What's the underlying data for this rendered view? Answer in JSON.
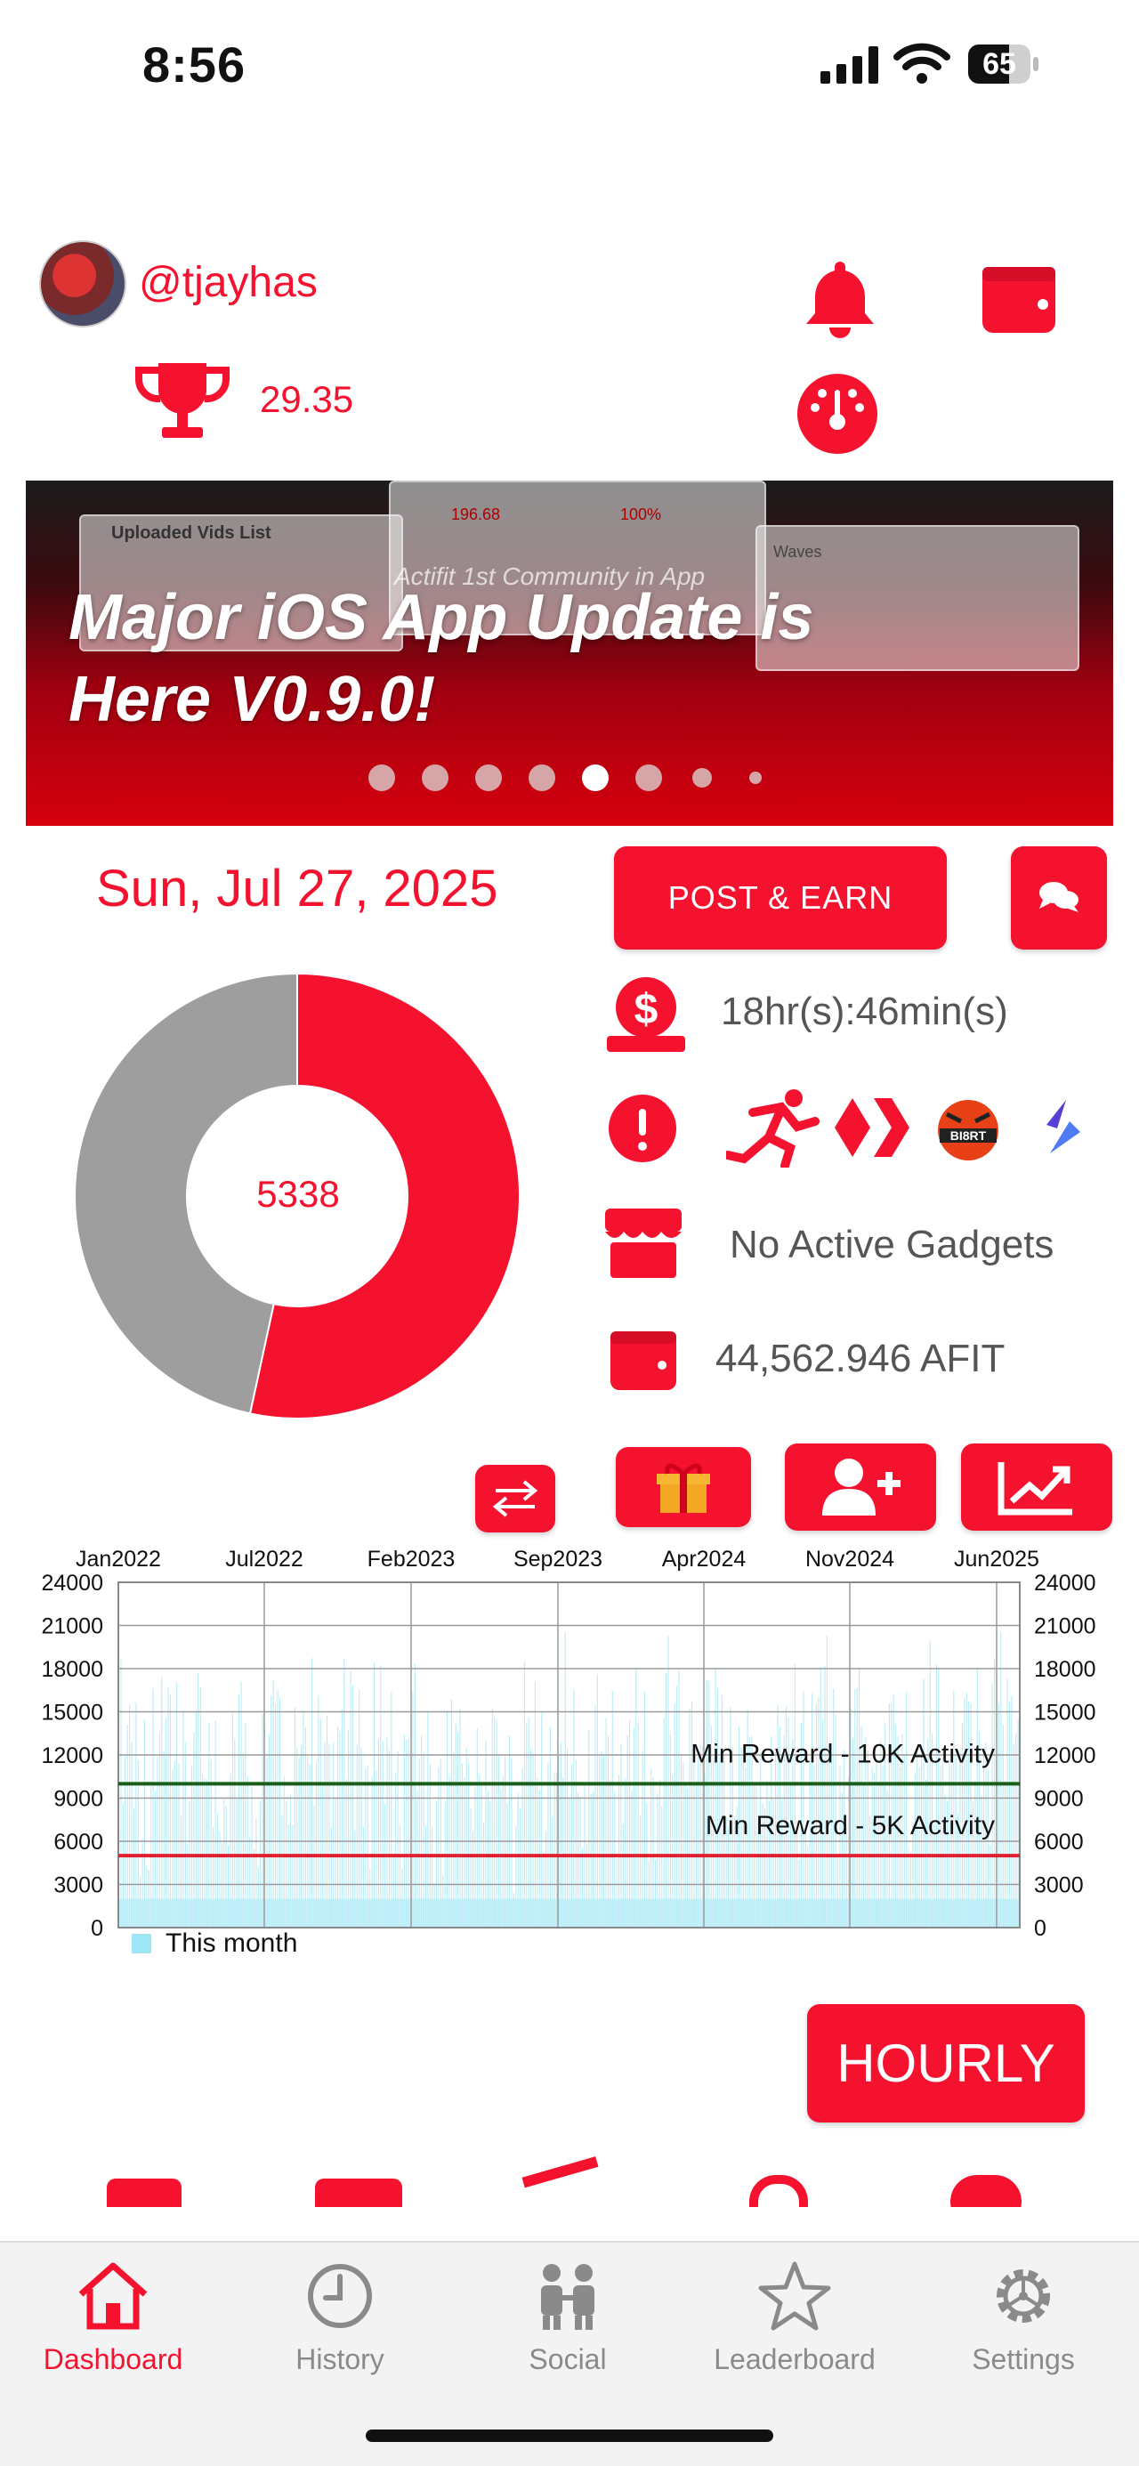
{
  "status_bar": {
    "time": "8:56",
    "battery": "65"
  },
  "header": {
    "username": "@tjayhas",
    "reward_value": "29.35",
    "icons": [
      "bell-icon",
      "wallet-icon",
      "gauge-icon",
      "trophy-icon"
    ]
  },
  "banner": {
    "title_line1": "Major iOS App Update is",
    "title_line2": "Here V0.9.0!",
    "slide_count": 8,
    "active_slide": 5,
    "mock_texts": {
      "uploaded": "Uploaded Vids List",
      "community": "Actifit 1st Community in App",
      "value": "196.68",
      "percent": "100%",
      "waves": "Waves"
    }
  },
  "dashboard": {
    "date": "Sun, Jul 27, 2025",
    "donut_value": "5338",
    "donut_fraction": 0.534,
    "post_earn_label": "POST & EARN",
    "timer": "18hr(s):46min(s)",
    "gadgets": "No Active Gadgets",
    "balance": "44,562.946 AFIT",
    "colors": {
      "accent": "#f4122f",
      "gray": "#9e9e9e"
    }
  },
  "chart_data": {
    "type": "bar",
    "x_ticks": [
      "Jan2022",
      "Jul2022",
      "Feb2023",
      "Sep2023",
      "Apr2024",
      "Nov2024",
      "Jun2025"
    ],
    "y_ticks": [
      "24000",
      "21000",
      "18000",
      "15000",
      "12000",
      "9000",
      "6000",
      "3000",
      "0"
    ],
    "ylim": [
      0,
      24000
    ],
    "legend": "This month",
    "legend_color": "#9ee6f5",
    "reference_lines": [
      {
        "label": "Min Reward - 10K Activity",
        "value": 10000,
        "color": "#1a5e1a"
      },
      {
        "label": "Min Reward - 5K Activity",
        "value": 5000,
        "color": "#e0202f"
      }
    ],
    "grid": true
  },
  "hourly_label": "HOURLY",
  "bottom_nav": [
    {
      "label": "Dashboard",
      "icon": "home-icon"
    },
    {
      "label": "History",
      "icon": "clock-icon"
    },
    {
      "label": "Social",
      "icon": "people-icon"
    },
    {
      "label": "Leaderboard",
      "icon": "star-icon"
    },
    {
      "label": "Settings",
      "icon": "gear-icon"
    }
  ]
}
